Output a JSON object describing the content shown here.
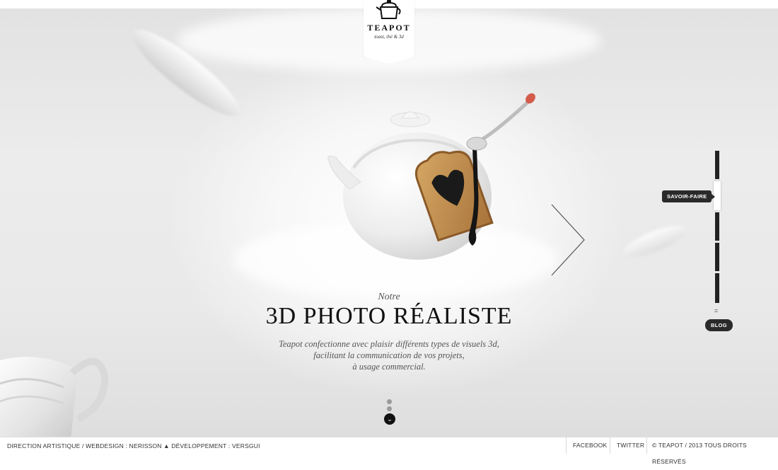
{
  "logo": {
    "title": "TEAPOT",
    "subtitle": "toast, thé & 3d",
    "icon": "teapot-icon"
  },
  "hero": {
    "kicker": "Notre",
    "headline": "3D PHOTO RÉALISTE",
    "description_lines": [
      "Teapot confectionne avec plaisir différents types de visuels 3d,",
      "facilitant la communication de vos projets,",
      "à usage commercial."
    ]
  },
  "nav": {
    "savoir_faire_label": "SAVOIR-FAIRE",
    "blog_label": "BLOG",
    "separator": "="
  },
  "footer": {
    "credits": "DIRECTION ARTISTIQUE / WEBDESIGN : NERISSON ▲ DÉVELOPPEMENT : VERSGUI",
    "facebook": "FACEBOOK",
    "twitter": "TWITTER",
    "copyright": "© TEAPOT / 2013 TOUS DROITS RÉSERVÉS"
  },
  "colors": {
    "background": "#eaeaea",
    "text_dark": "#111111",
    "nav_dark": "#2a2a2a"
  }
}
